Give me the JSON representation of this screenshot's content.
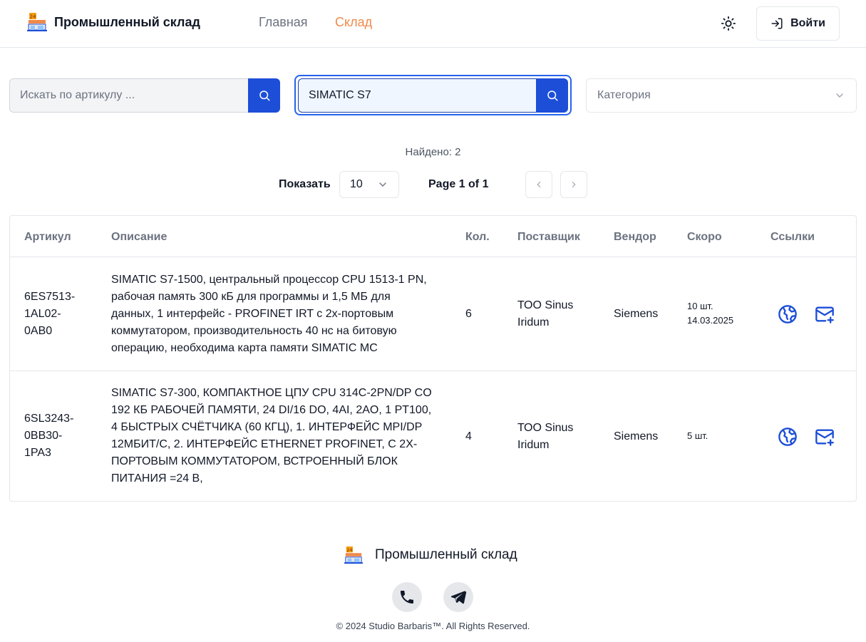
{
  "header": {
    "brand_name": "Промышленный склад",
    "nav": {
      "home": "Главная",
      "warehouse": "Склад"
    },
    "login_label": "Войти",
    "accent_color": "#f08a4b"
  },
  "search": {
    "article_placeholder": "Искать по артикулу ...",
    "article_value": "",
    "query_value": "SIMATIC S7",
    "category_placeholder": "Категория",
    "button_color": "#1d4ed8"
  },
  "results": {
    "found_text": "Найдено: 2",
    "show_label": "Показать",
    "page_size": "10",
    "page_info": "Page 1 of 1"
  },
  "table": {
    "columns": [
      "Артикул",
      "Описание",
      "Кол.",
      "Поставщик",
      "Вендор",
      "Скоро",
      "Ссылки"
    ],
    "rows": [
      {
        "article": [
          "6ES7513-",
          "1AL02-",
          "0AB0"
        ],
        "description": [
          "SIMATIC S7-1500, центральный процессор CPU 1513-1 PN,",
          "рабочая память 300 кБ для программы и 1,5 МБ для",
          "данных, 1 интерфейс - PROFINET IRT с 2х-портовым",
          "коммутатором, производительность 40 нс на битовую",
          "операцию, необходима карта памяти SIMATIC MC"
        ],
        "qty": "6",
        "supplier": [
          "ТОО Sinus",
          "Iridum"
        ],
        "vendor": "Siemens",
        "soon": [
          "10 шт.",
          "14.03.2025"
        ]
      },
      {
        "article": [
          "6SL3243-",
          "0BB30-",
          "1PA3"
        ],
        "description": [
          "SIMATIC S7-300, КОМПАКТНОЕ ЦПУ CPU 314C-2PN/DP CO",
          "192 КБ РАБОЧЕЙ ПАМЯТИ, 24 DI/16 DO, 4AI, 2AO, 1 PT100,",
          "4 БЫСТРЫХ СЧЁТЧИКА (60 КГЦ), 1. ИНТЕРФЕЙС MPI/DP",
          "12МБИТ/С, 2. ИНТЕРФЕЙС ETHERNET PROFINET, С 2Х-",
          "ПОРТОВЫМ КОММУТАТОРОМ, ВСТРОЕННЫЙ БЛОК",
          "ПИТАНИЯ =24 В,"
        ],
        "qty": "4",
        "supplier": [
          "ТОО Sinus",
          "Iridum"
        ],
        "vendor": "Siemens",
        "soon": [
          "5 шт."
        ]
      }
    ],
    "link_icons": [
      "globe-icon",
      "mail-plus-icon"
    ],
    "link_color": "#1d4ed8"
  },
  "footer": {
    "brand_name": "Промышленный склад",
    "social_icons": [
      "phone-icon",
      "telegram-icon"
    ],
    "copyright": "© 2024 Studio Barbaris™. All Rights Reserved."
  }
}
